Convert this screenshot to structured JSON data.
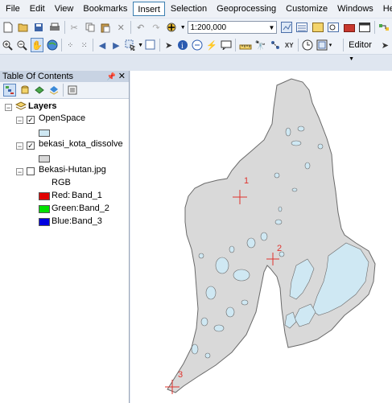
{
  "menubar": {
    "items": [
      "File",
      "Edit",
      "View",
      "Bookmarks",
      "Insert",
      "Selection",
      "Geoprocessing",
      "Customize",
      "Windows",
      "Help"
    ],
    "active": "Insert"
  },
  "toolbar": {
    "scale_value": "1:200,000",
    "editor_label": "Editor"
  },
  "toc": {
    "title": "Table Of Contents",
    "root": "Layers",
    "layers": [
      {
        "name": "OpenSpace",
        "checked": true,
        "swatch": "#cfe8f3"
      },
      {
        "name": "bekasi_kota_dissolve",
        "checked": true,
        "swatch": "#d7d7d7"
      },
      {
        "name": "Bekasi-Hutan.jpg",
        "checked": false
      }
    ],
    "rgb_label": "RGB",
    "bands": [
      {
        "label": "Red:",
        "band": "Band_1",
        "color": "#e00000"
      },
      {
        "label": "Green:",
        "band": "Band_2",
        "color": "#00e000"
      },
      {
        "label": "Blue:",
        "band": "Band_3",
        "color": "#0000e0"
      }
    ]
  },
  "map": {
    "control_points": [
      "1",
      "2",
      "3"
    ],
    "region_fill": "#d9d9d9",
    "openspace_fill": "#cfe8f3",
    "marker_color": "#e0332d"
  }
}
